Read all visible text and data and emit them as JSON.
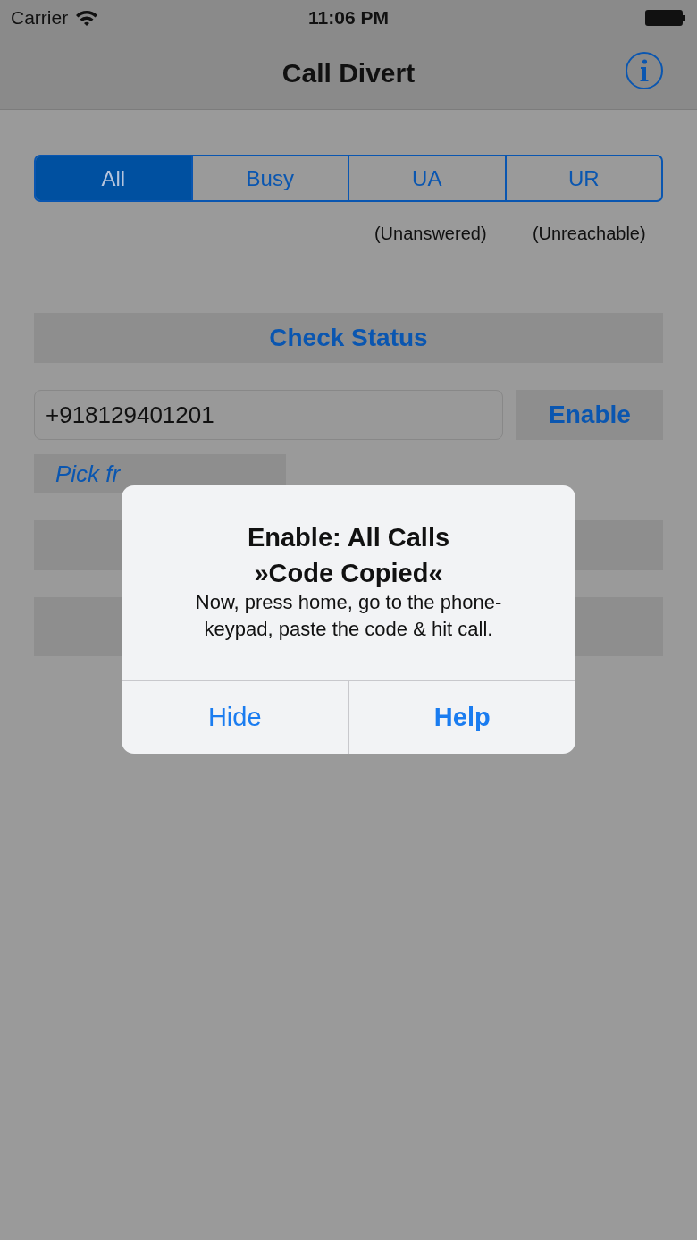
{
  "status_bar": {
    "carrier": "Carrier",
    "time": "11:06 PM"
  },
  "nav": {
    "title": "Call Divert"
  },
  "segments": [
    {
      "label": "All",
      "selected": true
    },
    {
      "label": "Busy",
      "selected": false
    },
    {
      "label": "UA",
      "selected": false,
      "note": "(Unanswered)"
    },
    {
      "label": "UR",
      "selected": false,
      "note": "(Unreachable)"
    }
  ],
  "check_status": "Check Status",
  "phone": {
    "value": "+918129401201"
  },
  "enable_button": "Enable",
  "pick_contacts": "Pick fr",
  "alert": {
    "title": "Enable: All Calls",
    "subtitle": "»Code Copied«",
    "message": "Now, press home, go to the phone-keypad, paste the code & hit call.",
    "buttons": [
      {
        "label": "Hide",
        "bold": false
      },
      {
        "label": "Help",
        "bold": true
      }
    ]
  }
}
